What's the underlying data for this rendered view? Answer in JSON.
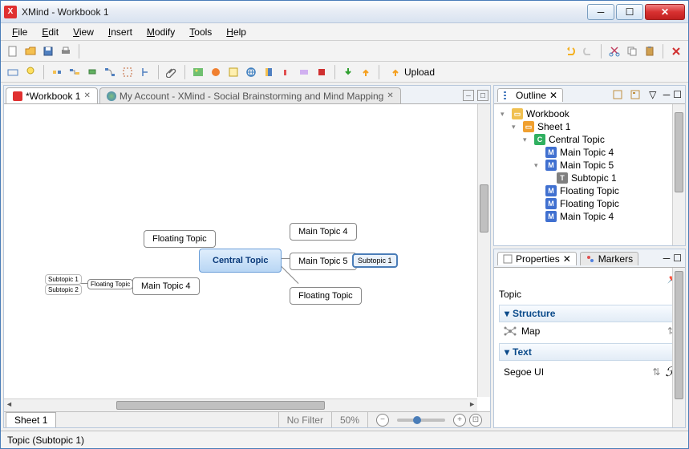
{
  "window": {
    "title": "XMind - Workbook 1"
  },
  "menu": {
    "file": "File",
    "edit": "Edit",
    "view": "View",
    "insert": "Insert",
    "modify": "Modify",
    "tools": "Tools",
    "help": "Help"
  },
  "toolbar2": {
    "upload": "Upload"
  },
  "tabs": {
    "workbook": "*Workbook 1",
    "browser": "My Account - XMind - Social Brainstorming and Mind Mapping"
  },
  "sheet": {
    "name": "Sheet 1",
    "filter": "No Filter",
    "zoom": "50%"
  },
  "mindmap": {
    "central": "Central Topic",
    "mt4a": "Main Topic 4",
    "mt5": "Main Topic 5",
    "sub1": "Subtopic 1",
    "float1": "Floating Topic",
    "float2": "Floating Topic",
    "float3": "Floating Topic",
    "mt4b": "Main Topic 4",
    "subt1": "Subtopic 1",
    "subt2": "Subtopic 2"
  },
  "outline": {
    "title": "Outline",
    "items": {
      "workbook": "Workbook",
      "sheet1": "Sheet 1",
      "central": "Central Topic",
      "mt4": "Main Topic 4",
      "mt5": "Main Topic 5",
      "sub1": "Subtopic 1",
      "float1": "Floating Topic",
      "float2": "Floating Topic",
      "mt4b": "Main Topic 4"
    }
  },
  "properties": {
    "tab": "Properties",
    "markers_tab": "Markers",
    "topic_label": "Topic",
    "structure": "Structure",
    "structure_val": "Map",
    "text": "Text",
    "font": "Segoe UI"
  },
  "status": {
    "text": "Topic (Subtopic 1)"
  }
}
